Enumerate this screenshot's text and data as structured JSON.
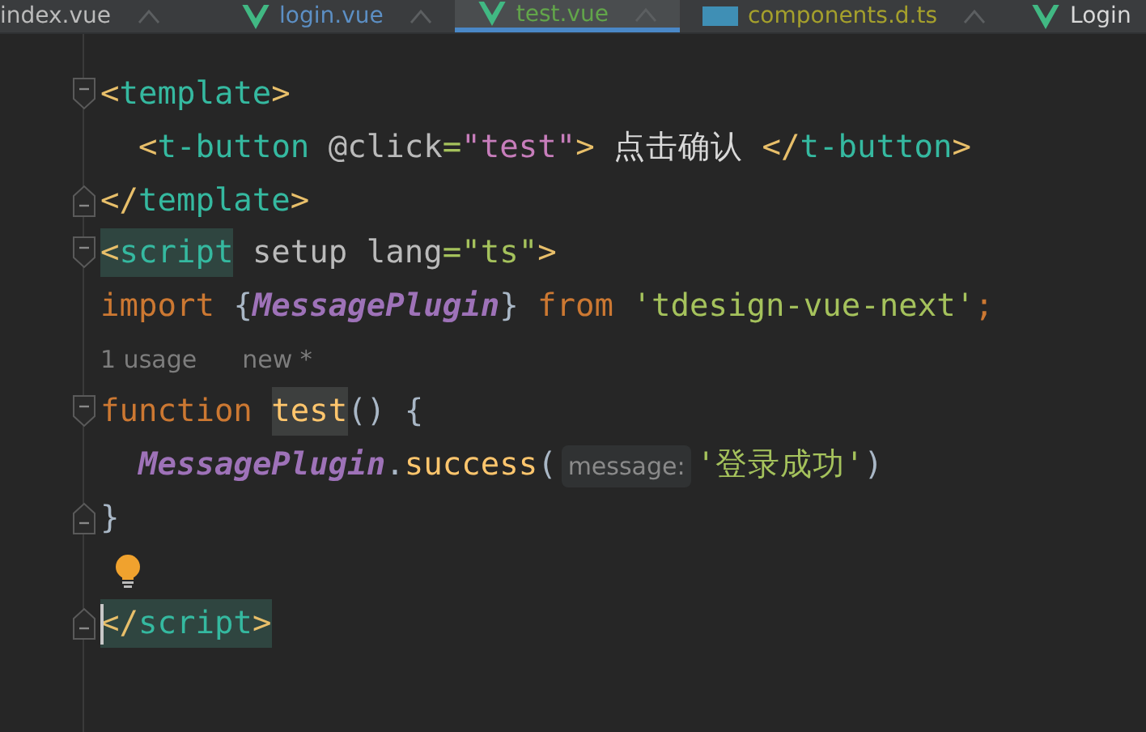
{
  "tabs": [
    {
      "label": "index.vue",
      "kind": "plain",
      "color": "#bbbbbb",
      "selected": false
    },
    {
      "label": "login.vue",
      "kind": "vue",
      "color": "#5c8fc4",
      "selected": false
    },
    {
      "label": "test.vue",
      "kind": "vue",
      "color": "#62a54a",
      "selected": true
    },
    {
      "label": "components.d.ts",
      "kind": "ts",
      "color": "#a5a02c",
      "selected": false
    },
    {
      "label": "Login",
      "kind": "vue",
      "color": "#d8d8d8",
      "selected": false
    }
  ],
  "lines": [
    {
      "kind": "code",
      "fold_start": true,
      "fold_end": false,
      "indented": false,
      "tokens": [
        {
          "t": "<",
          "kind": "bracket"
        },
        {
          "t": "template",
          "kind": "tag"
        },
        {
          "t": ">",
          "kind": "bracket"
        }
      ]
    },
    {
      "kind": "code",
      "fold_start": false,
      "fold_end": false,
      "indented": true,
      "tokens": [
        {
          "t": "<",
          "kind": "bracket"
        },
        {
          "t": "t-button",
          "kind": "tag"
        },
        {
          "t": " @click",
          "kind": "attr"
        },
        {
          "t": "=",
          "kind": "eq"
        },
        {
          "t": "\"test\"",
          "kind": "inject"
        },
        {
          "t": ">",
          "kind": "bracket"
        },
        {
          "t": " 点击确认 ",
          "kind": "text"
        },
        {
          "t": "</",
          "kind": "bracket"
        },
        {
          "t": "t-button",
          "kind": "tag"
        },
        {
          "t": ">",
          "kind": "bracket"
        }
      ]
    },
    {
      "kind": "code",
      "fold_start": false,
      "fold_end": true,
      "indented": false,
      "tokens": [
        {
          "t": "</",
          "kind": "bracket"
        },
        {
          "t": "template",
          "kind": "tag"
        },
        {
          "t": ">",
          "kind": "bracket"
        }
      ]
    },
    {
      "kind": "code",
      "fold_start": true,
      "fold_end": false,
      "indented": false,
      "tokens": [
        {
          "t": "<",
          "kind": "bracket",
          "hl": true
        },
        {
          "t": "script",
          "kind": "tag",
          "hl": true
        },
        {
          "t": " setup lang",
          "kind": "attr"
        },
        {
          "t": "=",
          "kind": "eq"
        },
        {
          "t": "\"ts\"",
          "kind": "string"
        },
        {
          "t": ">",
          "kind": "bracket"
        }
      ]
    },
    {
      "kind": "code",
      "fold_start": false,
      "fold_end": false,
      "indented": false,
      "tokens": [
        {
          "t": "import",
          "kind": "keyword"
        },
        {
          "t": " {",
          "kind": "punct"
        },
        {
          "t": "MessagePlugin",
          "kind": "class"
        },
        {
          "t": "}",
          "kind": "punct"
        },
        {
          "t": " from ",
          "kind": "keyword"
        },
        {
          "t": "'tdesign-vue-next'",
          "kind": "string"
        },
        {
          "t": ";",
          "kind": "keyword"
        }
      ]
    },
    {
      "kind": "hint",
      "fold_start": false,
      "fold_end": false,
      "usages": "1 usage",
      "status": "new *"
    },
    {
      "kind": "code",
      "fold_start": true,
      "fold_end": false,
      "indented": false,
      "tokens": [
        {
          "t": "function ",
          "kind": "keyword"
        },
        {
          "t": "test",
          "kind": "function",
          "hl": true
        },
        {
          "t": "() {",
          "kind": "punct"
        }
      ]
    },
    {
      "kind": "code",
      "fold_start": false,
      "fold_end": false,
      "indented": true,
      "tokens": [
        {
          "t": "MessagePlugin",
          "kind": "class"
        },
        {
          "t": ".",
          "kind": "punct"
        },
        {
          "t": "success",
          "kind": "function"
        },
        {
          "t": "(",
          "kind": "punct"
        },
        {
          "t": "message:",
          "kind": "inlay"
        },
        {
          "t": "'登录成功'",
          "kind": "string"
        },
        {
          "t": ")",
          "kind": "punct"
        }
      ]
    },
    {
      "kind": "code",
      "fold_start": false,
      "fold_end": true,
      "indented": false,
      "tokens": [
        {
          "t": "}",
          "kind": "punct"
        }
      ]
    },
    {
      "kind": "bulb",
      "fold_start": false,
      "fold_end": false
    },
    {
      "kind": "code",
      "fold_start": false,
      "fold_end": true,
      "indented": false,
      "caret": true,
      "tokens": [
        {
          "t": "</",
          "kind": "bracket",
          "hl": true
        },
        {
          "t": "script",
          "kind": "tag",
          "hl": true
        },
        {
          "t": ">",
          "kind": "bracket",
          "hl": true
        }
      ]
    }
  ]
}
